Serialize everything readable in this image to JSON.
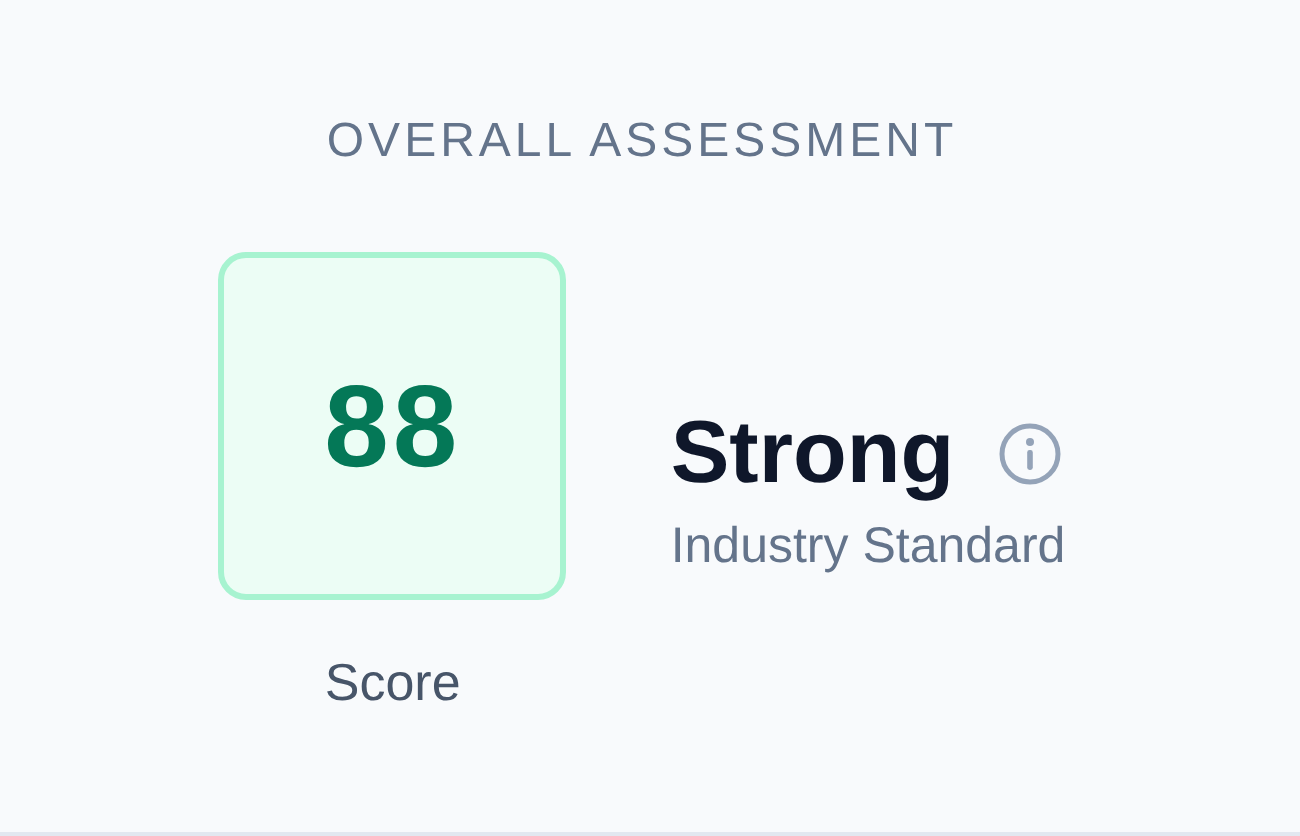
{
  "title": "OVERALL ASSESSMENT",
  "score": {
    "value": "88",
    "label": "Score"
  },
  "rating": {
    "label": "Strong",
    "subtitle": "Industry Standard"
  }
}
